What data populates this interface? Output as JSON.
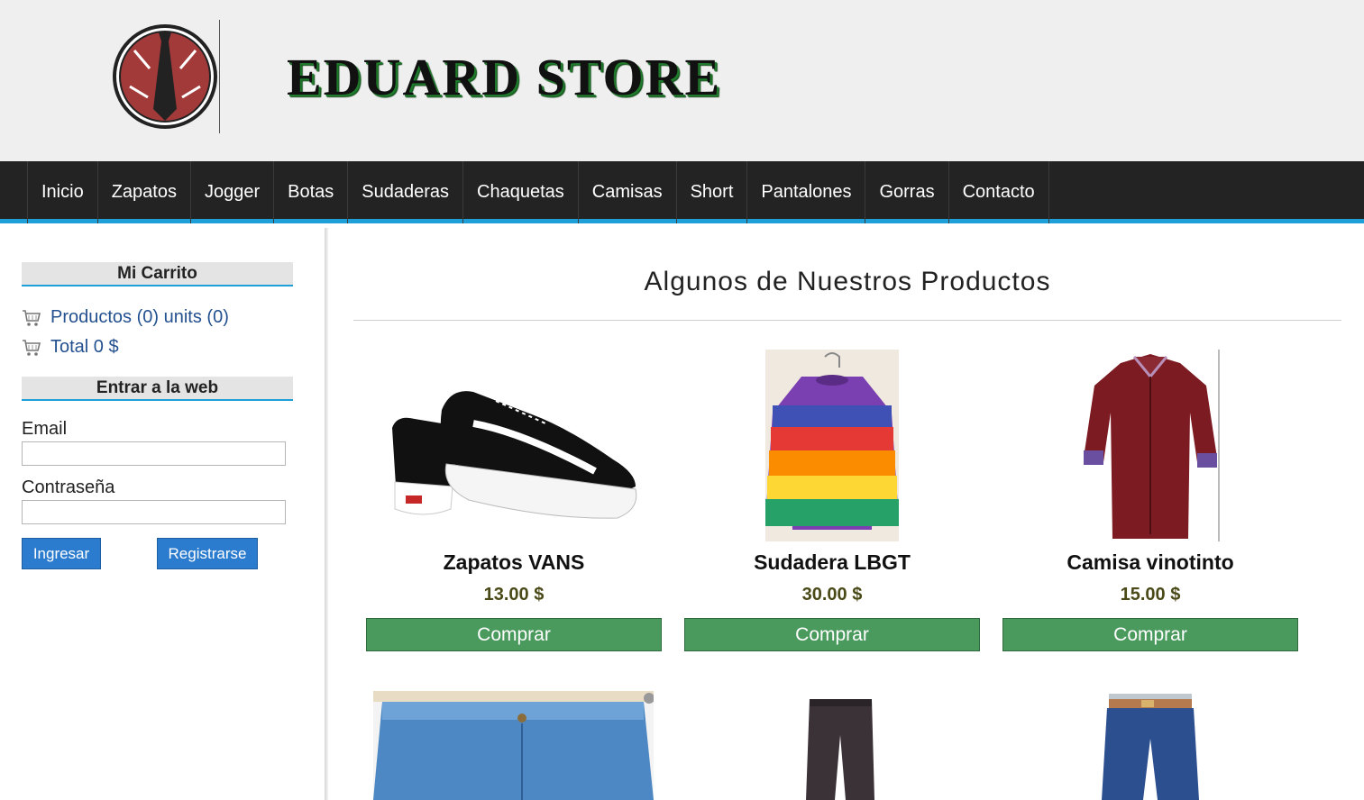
{
  "header": {
    "brand": "EDUARD STORE",
    "logo_icon": "tie-logo-icon"
  },
  "nav": {
    "items": [
      "Inicio",
      "Zapatos",
      "Jogger",
      "Botas",
      "Sudaderas",
      "Chaquetas",
      "Camisas",
      "Short",
      "Pantalones",
      "Gorras",
      "Contacto"
    ]
  },
  "sidebar": {
    "cart_title": "Mi Carrito",
    "cart_products": "Productos (0) units (0)",
    "cart_total": "Total 0 $",
    "login_title": "Entrar a la web",
    "email_label": "Email",
    "email_value": "",
    "password_label": "Contraseña",
    "password_value": "",
    "login_button": "Ingresar",
    "register_button": "Registrarse"
  },
  "main": {
    "title": "Algunos de Nuestros Productos",
    "products": [
      {
        "name": "Zapatos VANS",
        "price": "13.00 $",
        "button": "Comprar",
        "image": "sneaker-image"
      },
      {
        "name": "Sudadera LBGT",
        "price": "30.00 $",
        "button": "Comprar",
        "image": "rainbow-sweater-image"
      },
      {
        "name": "Camisa vinotinto",
        "price": "15.00 $",
        "button": "Comprar",
        "image": "red-shirt-image"
      }
    ],
    "more_products": [
      {
        "image": "jeans-shorts-image"
      },
      {
        "image": "grey-pants-image"
      },
      {
        "image": "blue-pants-image"
      }
    ]
  },
  "colors": {
    "nav_bg": "#232323",
    "nav_accent": "#1f9fd8",
    "buy_button": "#4a9a5e",
    "primary_button": "#2b7bce"
  }
}
